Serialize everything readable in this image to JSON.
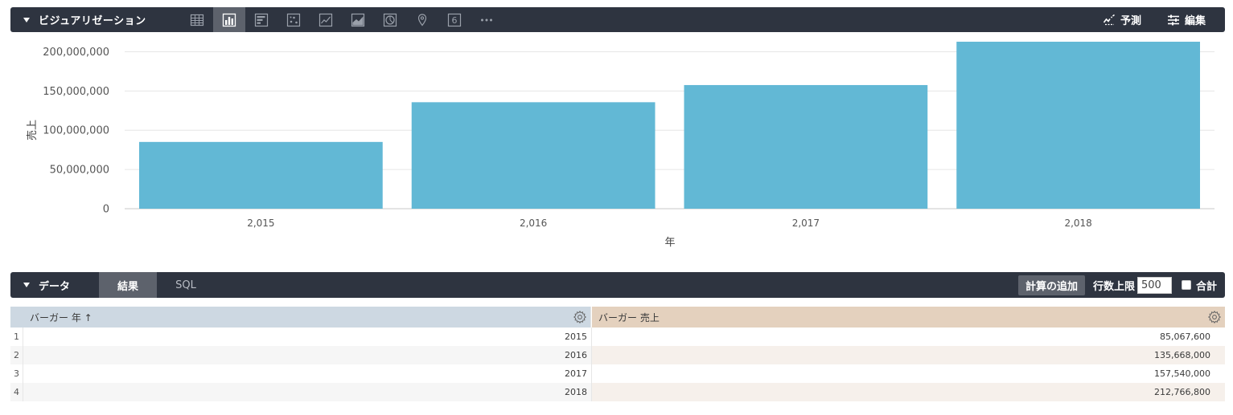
{
  "visualization": {
    "title": "ビジュアリゼーション",
    "icons": [
      "table-icon",
      "column-chart-icon",
      "bar-chart-icon",
      "scatter-icon",
      "line-chart-icon",
      "area-chart-icon",
      "pie-chart-icon",
      "map-pin-icon",
      "single-value-icon",
      "more-icon"
    ],
    "single_value_glyph": "6",
    "forecast_label": "予測",
    "edit_label": "編集"
  },
  "chart_data": {
    "type": "bar",
    "categories": [
      "2,015",
      "2,016",
      "2,017",
      "2,018"
    ],
    "values": [
      85067600,
      135668000,
      157540000,
      212766800
    ],
    "xlabel": "年",
    "ylabel": "売上",
    "ylim": [
      0,
      225000000
    ],
    "yticks": [
      0,
      50000000,
      100000000,
      150000000,
      200000000
    ],
    "ytick_labels": [
      "0",
      "50,000,000",
      "100,000,000",
      "150,000,000",
      "200,000,000"
    ],
    "grid": true,
    "color": "#62b8d5"
  },
  "data_panel": {
    "title": "データ",
    "tab_results": "結果",
    "tab_sql": "SQL",
    "add_calc_label": "計算の追加",
    "row_limit_label": "行数上限",
    "row_limit_value": "500",
    "totals_label": "合計"
  },
  "table": {
    "columns": [
      "バーガー 年 ↑",
      "バーガー 売上"
    ],
    "rows": [
      {
        "index": "1",
        "year": "2015",
        "sales": "85,067,600"
      },
      {
        "index": "2",
        "year": "2016",
        "sales": "135,668,000"
      },
      {
        "index": "3",
        "year": "2017",
        "sales": "157,540,000"
      },
      {
        "index": "4",
        "year": "2018",
        "sales": "212,766,800"
      }
    ]
  }
}
